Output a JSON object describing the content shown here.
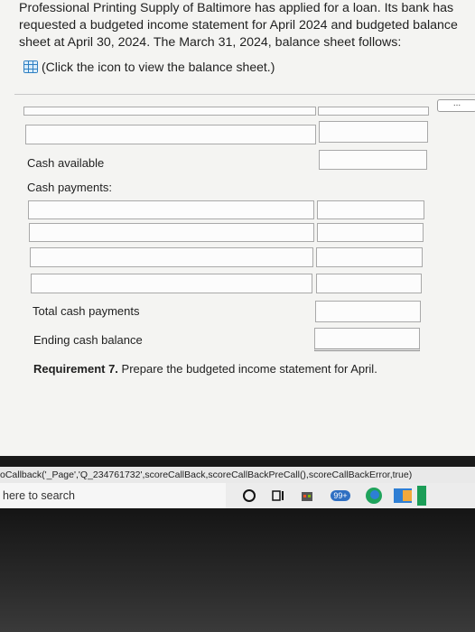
{
  "intro": {
    "text": "Professional Printing Supply of Baltimore has applied for a loan. Its bank has requested a budgeted income statement for April 2024 and budgeted balance sheet at April 30, 2024. The March 31, 2024, balance sheet follows:",
    "link_text": "(Click the icon to view the balance sheet.)"
  },
  "more_button": "...",
  "labels": {
    "cash_available": "Cash available",
    "cash_payments": "Cash payments:",
    "total_cash_payments": "Total cash payments",
    "ending_cash_balance": "Ending cash balance",
    "requirement_bold": "Requirement 7.",
    "requirement_text": " Prepare the budgeted income statement for April."
  },
  "status_bar": "oCallback('_Page','Q_234761732',scoreCallBack,scoreCallBackPreCall(),scoreCallBackError,true)",
  "taskbar": {
    "search_text": "here to search",
    "badge": "99+"
  }
}
